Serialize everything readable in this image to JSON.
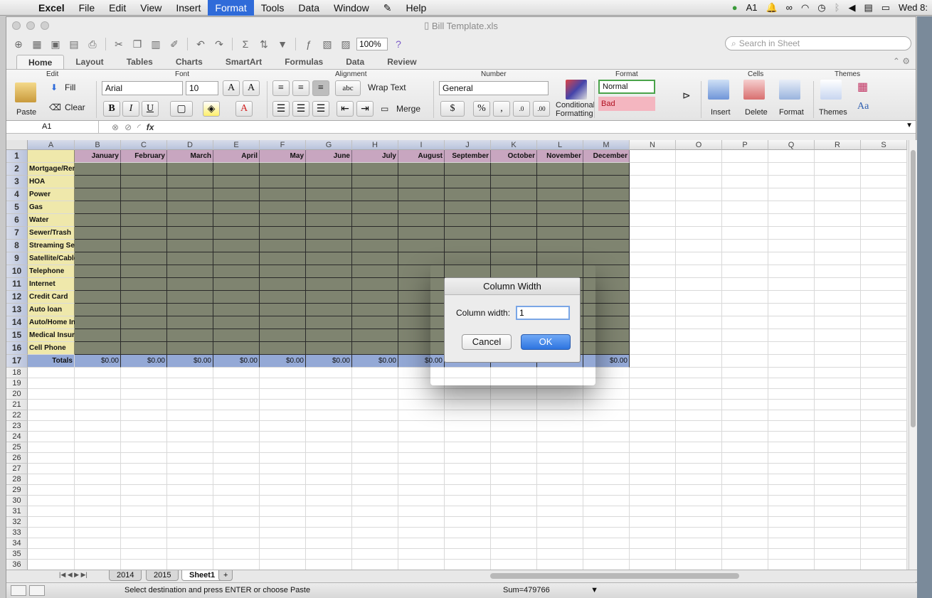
{
  "menubar": {
    "app": "Excel",
    "items": [
      "File",
      "Edit",
      "View",
      "Insert",
      "Format",
      "Tools",
      "Data",
      "Window",
      "Help"
    ],
    "active": "Format",
    "clock": "Wed 8:",
    "input_indicator": "1"
  },
  "window": {
    "title": "Bill Template.xls"
  },
  "toolbar": {
    "zoom": "100%",
    "search_placeholder": "Search in Sheet"
  },
  "ribbon_tabs": [
    "Home",
    "Layout",
    "Tables",
    "Charts",
    "SmartArt",
    "Formulas",
    "Data",
    "Review"
  ],
  "ribbon": {
    "groups": {
      "edit": "Edit",
      "font": "Font",
      "alignment": "Alignment",
      "number": "Number",
      "format": "Format",
      "cells": "Cells",
      "themes": "Themes"
    },
    "paste": "Paste",
    "fill": "Fill",
    "clear": "Clear",
    "font_name": "Arial",
    "font_size": "10",
    "bold": "B",
    "italic": "I",
    "underline": "U",
    "wrap_text": "Wrap Text",
    "merge": "Merge",
    "abc": "abc",
    "number_format": "General",
    "percent": "%",
    "comma": ",",
    "conditional": "Conditional",
    "formatting": "Formatting",
    "style_normal": "Normal",
    "style_bad": "Bad",
    "insert": "Insert",
    "delete": "Delete",
    "format": "Format",
    "themes": "Themes"
  },
  "formula_bar": {
    "cell_ref": "A1",
    "fx": "fx",
    "content": ""
  },
  "columns": [
    "A",
    "B",
    "C",
    "D",
    "E",
    "F",
    "G",
    "H",
    "I",
    "J",
    "K",
    "L",
    "M",
    "N",
    "O",
    "P",
    "Q",
    "R",
    "S"
  ],
  "months": [
    "January",
    "February",
    "March",
    "April",
    "May",
    "June",
    "July",
    "August",
    "September",
    "October",
    "November",
    "December"
  ],
  "row_labels": [
    "Mortgage/Rent",
    "HOA",
    "Power",
    "Gas",
    "Water",
    "Sewer/Trash",
    "Streaming Services",
    "Satellite/Cable",
    "Telephone",
    "Internet",
    "Credit Card",
    "Auto loan",
    "Auto/Home Insurance",
    "Medical Insurance",
    "Cell Phone"
  ],
  "totals_label": "Totals",
  "totals": [
    "$0.00",
    "$0.00",
    "$0.00",
    "$0.00",
    "$0.00",
    "$0.00",
    "$0.00",
    "$0.00",
    "",
    "",
    "",
    "$0.00"
  ],
  "empty_rows": [
    "18",
    "19",
    "20",
    "21",
    "22",
    "23",
    "24",
    "25",
    "26",
    "27",
    "28",
    "29",
    "30",
    "31",
    "32",
    "33",
    "34",
    "35",
    "36"
  ],
  "sheet_tabs": [
    "2014",
    "2015",
    "Sheet1"
  ],
  "active_sheet": "Sheet1",
  "status": {
    "message": "Select destination and press ENTER or choose Paste",
    "sum": "Sum=479766"
  },
  "dialog": {
    "title": "Column Width",
    "label": "Column width:",
    "value": "1",
    "cancel": "Cancel",
    "ok": "OK"
  }
}
